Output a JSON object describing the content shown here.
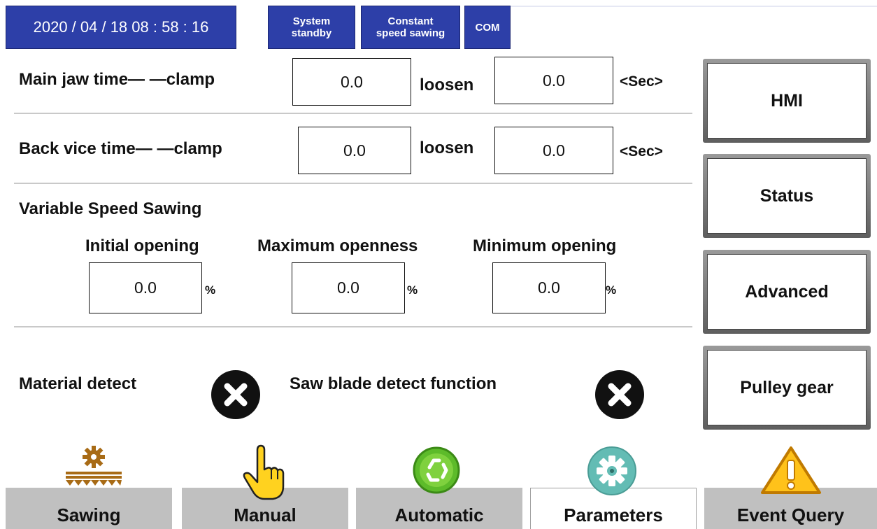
{
  "header": {
    "datetime": "2020 / 04 / 18   08 : 58 : 16",
    "status": "System\nstandby",
    "mode": "Constant\nspeed sawing",
    "com": "COM"
  },
  "jaw": {
    "main_label": "Main jaw time— —clamp",
    "main_clamp": "0.0",
    "main_loosen_label": "loosen",
    "main_loosen": "0.0",
    "main_unit": "<Sec>",
    "back_label": "Back vice time— —clamp",
    "back_clamp": "0.0",
    "back_loosen_label": "loosen",
    "back_loosen": "0.0",
    "back_unit": "<Sec>"
  },
  "variable": {
    "title": "Variable Speed Sawing",
    "initial_label": "Initial opening",
    "max_label": "Maximum openness",
    "min_label": "Minimum opening",
    "initial_value": "0.0",
    "max_value": "0.0",
    "min_value": "0.0",
    "unit": "%"
  },
  "detect": {
    "material_label": "Material detect",
    "material_state_icon": "x-circle-icon",
    "saw_blade_label": "Saw blade detect function",
    "saw_blade_state_icon": "x-circle-icon"
  },
  "side_buttons": {
    "hmi": "HMI",
    "status": "Status",
    "advanced": "Advanced",
    "pulley": "Pulley gear"
  },
  "tabs": {
    "sawing": "Sawing",
    "manual": "Manual",
    "automatic": "Automatic",
    "parameters": "Parameters",
    "event_query": "Event Query",
    "active": "Parameters"
  },
  "colors": {
    "header_bg": "#2d3fa8",
    "tab_bg": "#c0c0c0",
    "icon_black": "#111111"
  }
}
